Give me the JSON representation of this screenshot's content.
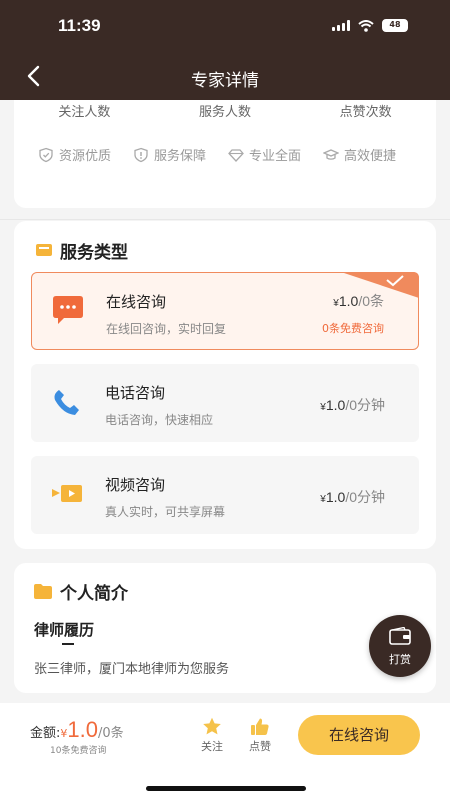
{
  "status_bar": {
    "time": "11:39",
    "battery": "48"
  },
  "header": {
    "title": "专家详情"
  },
  "stats": {
    "labels": [
      "关注人数",
      "服务人数",
      "点赞次数"
    ]
  },
  "features": [
    {
      "icon": "shield-check-icon",
      "label": "资源优质"
    },
    {
      "icon": "shield-alert-icon",
      "label": "服务保障"
    },
    {
      "icon": "diamond-icon",
      "label": "专业全面"
    },
    {
      "icon": "graduation-cap-icon",
      "label": "高效便捷"
    }
  ],
  "services": {
    "title": "服务类型",
    "options": [
      {
        "name": "在线咨询",
        "desc": "在线回咨询，实时回复",
        "price_symbol": "¥",
        "price": "1.0",
        "unit": "/0条",
        "free": "0条免费咨询",
        "selected": true,
        "icon": "chat-bubble-icon"
      },
      {
        "name": "电话咨询",
        "desc": "电话咨询，快速相应",
        "price_symbol": "¥",
        "price": "1.0",
        "unit": "/0分钟",
        "selected": false,
        "icon": "phone-icon"
      },
      {
        "name": "视频咨询",
        "desc": "真人实时，可共享屏幕",
        "price_symbol": "¥",
        "price": "1.0",
        "unit": "/0分钟",
        "selected": false,
        "icon": "video-icon"
      }
    ]
  },
  "profile": {
    "title": "个人简介",
    "resume_title": "律师履历",
    "resume_text": "张三律师，厦门本地律师为您服务"
  },
  "tip_button": {
    "label": "打赏"
  },
  "bottom_bar": {
    "amount_label": "金额:",
    "price_symbol": "¥",
    "amount": "1.0",
    "unit": "/0条",
    "free_note": "10条免费咨询",
    "follow_label": "关注",
    "like_label": "点赞",
    "consult_button": "在线咨询"
  },
  "colors": {
    "header_bg": "#3a2a25",
    "accent": "#f06a3b",
    "cta": "#f9c54d",
    "selected_border": "#f08a5d"
  }
}
